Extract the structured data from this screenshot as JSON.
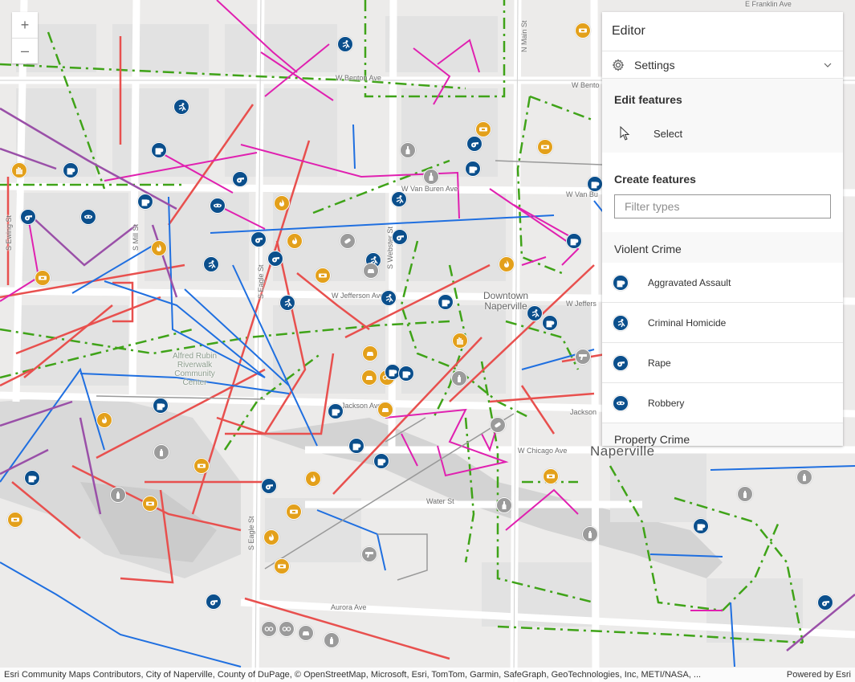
{
  "zoom": {
    "in_label": "+",
    "out_label": "–"
  },
  "editor": {
    "title": "Editor",
    "settings_label": "Settings",
    "edit_features_label": "Edit features",
    "select_label": "Select",
    "create_features_label": "Create features",
    "filter_placeholder": "Filter types",
    "violent_group_label": "Violent Crime",
    "types": [
      {
        "label": "Aggravated Assault",
        "icon": "fist-icon"
      },
      {
        "label": "Criminal Homicide",
        "icon": "homicide-icon"
      },
      {
        "label": "Rape",
        "icon": "whistle-icon"
      },
      {
        "label": "Robbery",
        "icon": "mask-icon"
      }
    ],
    "property_group_label": "Property Crime"
  },
  "map_labels": {
    "franklin": "E Franklin Ave",
    "benton_w": "W Benton Ave",
    "benton_e": "W Bento",
    "van_buren": "W Van Buren Ave",
    "van_bu_e": "W Van Bu",
    "jefferson": "W Jefferson Ave",
    "jeffers_e": "W Jeffers",
    "jackson": "Jackson Ave",
    "jackson_e": "Jackson",
    "chicago": "W Chicago Ave",
    "water": "Water St",
    "aurora": "Aurora Ave",
    "downtown_line1": "Downtown",
    "downtown_line2": "Naperville",
    "naperville": "Naperville",
    "riverwalk_1": "Alfred Rubin",
    "riverwalk_2": "Riverwalk",
    "riverwalk_3": "Community",
    "riverwalk_4": "Center",
    "ewing": "S Ewing St",
    "mill": "S Mill St",
    "eagle": "S Eagle St",
    "eagle_s": "S Eagle St",
    "webster": "S Webster St",
    "main": "N Main St"
  },
  "colors": {
    "violent": "#0b4f8c",
    "property": "#e3a01b",
    "other": "#9b9b9b",
    "line_red": "#e8504e",
    "line_blue": "#1f6fe0",
    "line_magenta": "#e020b0",
    "line_purple": "#9a50a8",
    "line_green": "#3fa318"
  },
  "attribution": {
    "sources": "Esri Community Maps Contributors, City of Naperville, County of DuPage, © OpenStreetMap, Microsoft, Esri, TomTom, Garmin, SafeGraph, GeoTechnologies, Inc, METI/NASA, ...",
    "powered_by": "Powered by Esri"
  }
}
